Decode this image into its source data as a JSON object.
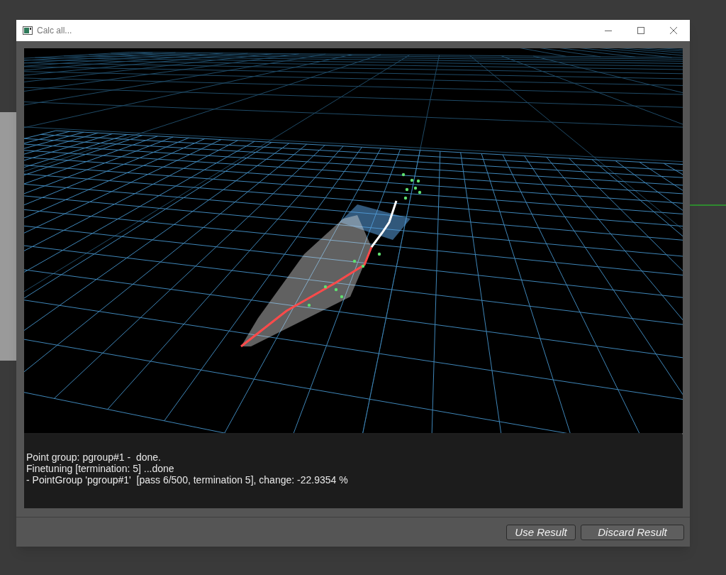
{
  "window": {
    "title": "Calc all..."
  },
  "log": [
    "Point group: pgroup#1 -  done.",
    "Finetuning [termination: 5] ...done",
    "- PointGroup 'pgroup#1'  [pass 6/500, termination 5], change: -22.9354 %"
  ],
  "buttons": [
    "Use Result",
    "Discard Result"
  ]
}
